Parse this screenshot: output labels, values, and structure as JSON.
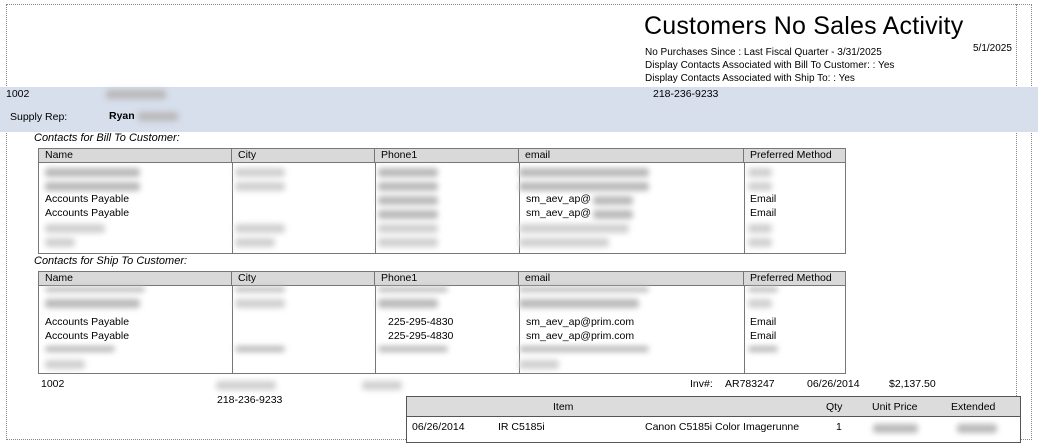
{
  "report": {
    "title": "Customers No Sales Activity",
    "date": "5/1/2025",
    "params": [
      "No Purchases Since : Last Fiscal Quarter - 3/31/2025",
      "Display Contacts Associated with Bill To Customer: : Yes",
      "Display Contacts Associated with Ship To: : Yes"
    ]
  },
  "customer": {
    "number": "1002",
    "phone": "218-236-9233",
    "supply_rep_label": "Supply Rep:",
    "supply_rep_name": "Ryan"
  },
  "bill_to": {
    "label": "Contacts for Bill To Customer:",
    "columns": [
      "Name",
      "City",
      "Phone1",
      "email",
      "Preferred Method"
    ],
    "rows": [
      {
        "name": "",
        "city": "",
        "phone": "",
        "email": "",
        "method": ""
      },
      {
        "name": "",
        "city": "",
        "phone": "",
        "email": "",
        "method": ""
      },
      {
        "name": "Accounts Payable",
        "city": "",
        "phone": "",
        "email": "sm_aev_ap@",
        "method": "Email"
      },
      {
        "name": "Accounts Payable",
        "city": "",
        "phone": "",
        "email": "sm_aev_ap@",
        "method": "Email"
      },
      {
        "name": "",
        "city": "",
        "phone": "",
        "email": "",
        "method": ""
      },
      {
        "name": "",
        "city": "",
        "phone": "",
        "email": "",
        "method": ""
      }
    ]
  },
  "ship_to": {
    "label": "Contacts for Ship To Customer:",
    "columns": [
      "Name",
      "City",
      "Phone1",
      "email",
      "Preferred Method"
    ],
    "rows": [
      {
        "name": "",
        "city": "",
        "phone": "",
        "email": "",
        "method": ""
      },
      {
        "name": "",
        "city": "",
        "phone": "",
        "email": "",
        "method": ""
      },
      {
        "name": "Accounts Payable",
        "city": "",
        "phone": "225-295-4830",
        "email": "sm_aev_ap@prim.com",
        "method": "Email"
      },
      {
        "name": "Accounts Payable",
        "city": "",
        "phone": "225-295-4830",
        "email": "sm_aev_ap@prim.com",
        "method": "Email"
      },
      {
        "name": "",
        "city": "",
        "phone": "",
        "email": "",
        "method": ""
      },
      {
        "name": "",
        "city": "",
        "phone": "",
        "email": "",
        "method": ""
      }
    ]
  },
  "invoice": {
    "customer_number": "1002",
    "phone": "218-236-9233",
    "inv_label": "Inv#:",
    "inv_number": "AR783247",
    "date": "06/26/2014",
    "amount": "$2,137.50",
    "columns": [
      "Item",
      "Qty",
      "Unit Price",
      "Extended"
    ],
    "line": {
      "date": "06/26/2014",
      "item": "IR C5185i",
      "description": "Canon C5185i Color Imagerunne",
      "qty": "1"
    }
  }
}
